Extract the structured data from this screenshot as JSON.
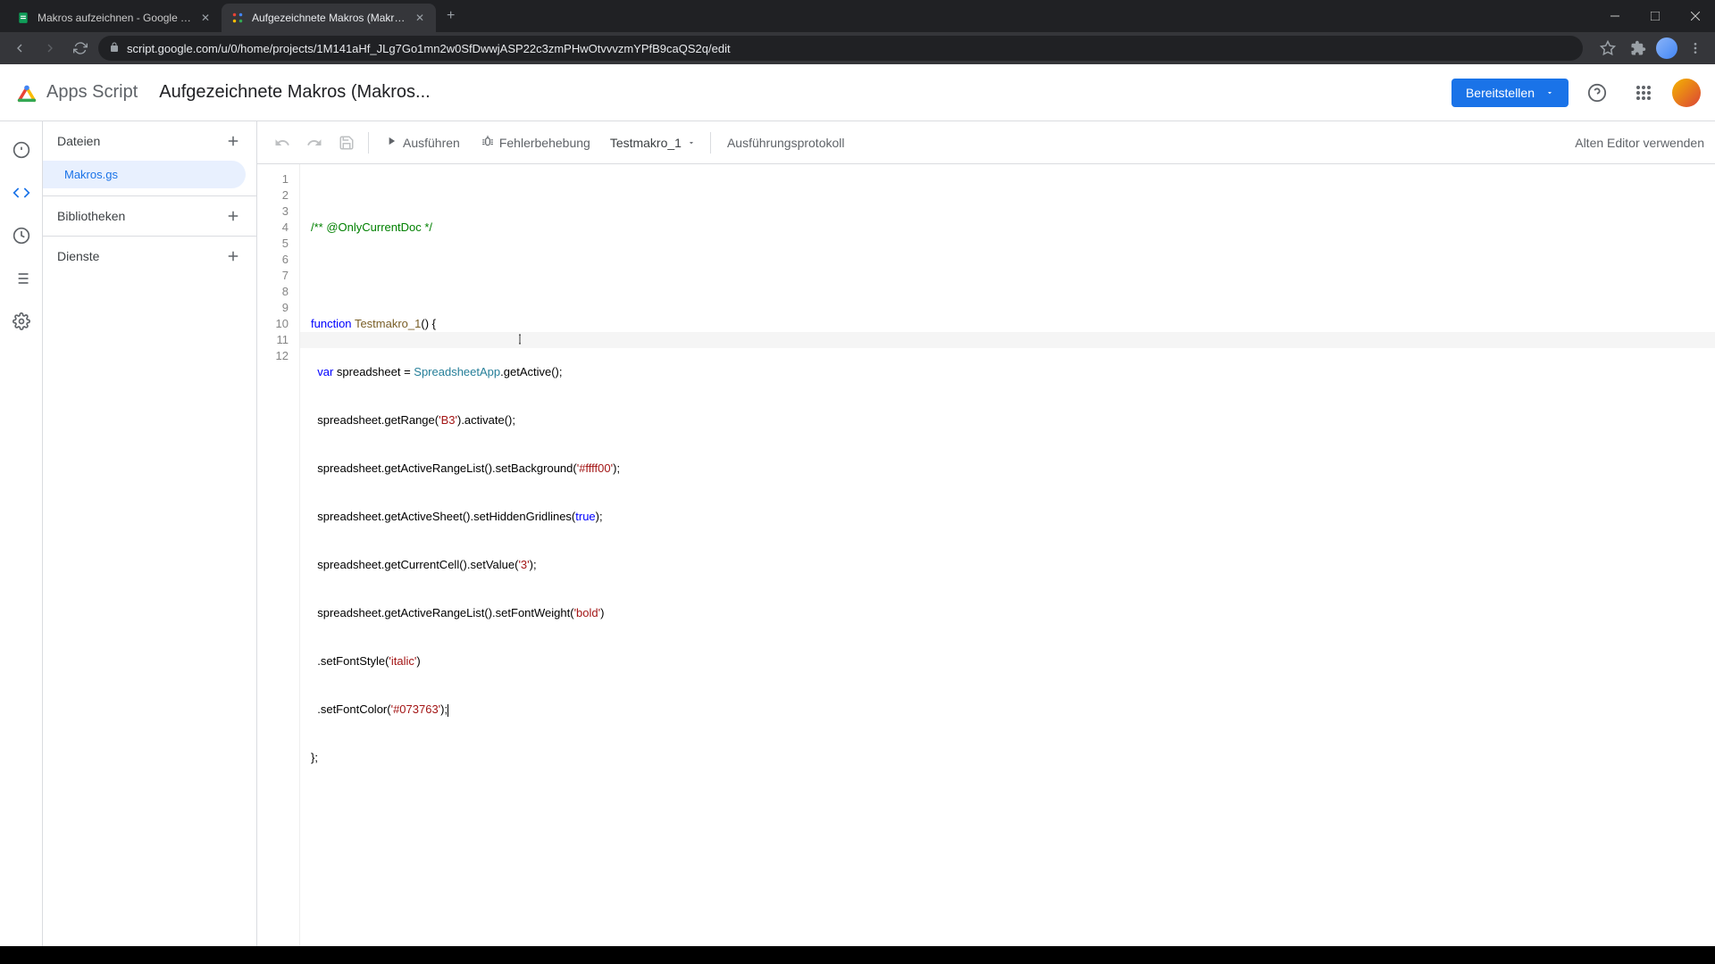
{
  "browser": {
    "tabs": [
      {
        "title": "Makros aufzeichnen - Google Ta"
      },
      {
        "title": "Aufgezeichnete Makros (Makros"
      }
    ],
    "url": "script.google.com/u/0/home/projects/1M141aHf_JLg7Go1mn2w0SfDwwjASP22c3zmPHwOtvvvzmYPfB9caQS2q/edit"
  },
  "header": {
    "app_name": "Apps Script",
    "project_title": "Aufgezeichnete Makros (Makros...",
    "deploy": "Bereitstellen"
  },
  "sidebar": {
    "files": "Dateien",
    "file_item": "Makros.gs",
    "libraries": "Bibliotheken",
    "services": "Dienste"
  },
  "toolbar": {
    "run": "Ausführen",
    "debug": "Fehlerbehebung",
    "func": "Testmakro_1",
    "log": "Ausführungsprotokoll",
    "old_editor": "Alten Editor verwenden"
  },
  "code": {
    "lines": [
      "1",
      "2",
      "3",
      "4",
      "5",
      "6",
      "7",
      "8",
      "9",
      "10",
      "11",
      "12"
    ],
    "l1_comment": "/** @OnlyCurrentDoc */",
    "l3_kw": "function",
    "l3_name": "Testmakro_1",
    "l3_rest": "() {",
    "l4_kw": "var",
    "l4_v": " spreadsheet = ",
    "l4_cls": "SpreadsheetApp",
    "l4_rest": ".getActive();",
    "l5_a": "  spreadsheet.getRange(",
    "l5_s": "'B3'",
    "l5_b": ").activate();",
    "l6_a": "  spreadsheet.getActiveRangeList().setBackground(",
    "l6_s": "'#ffff00'",
    "l6_b": ");",
    "l7_a": "  spreadsheet.getActiveSheet().setHiddenGridlines(",
    "l7_s": "true",
    "l7_b": ");",
    "l8_a": "  spreadsheet.getCurrentCell().setValue(",
    "l8_s": "'3'",
    "l8_b": ");",
    "l9_a": "  spreadsheet.getActiveRangeList().setFontWeight(",
    "l9_s": "'bold'",
    "l9_b": ")",
    "l10_a": "  .setFontStyle(",
    "l10_s": "'italic'",
    "l10_b": ")",
    "l11_a": "  .setFontColor(",
    "l11_s": "'#073763'",
    "l11_b": ");",
    "l12": "};"
  }
}
